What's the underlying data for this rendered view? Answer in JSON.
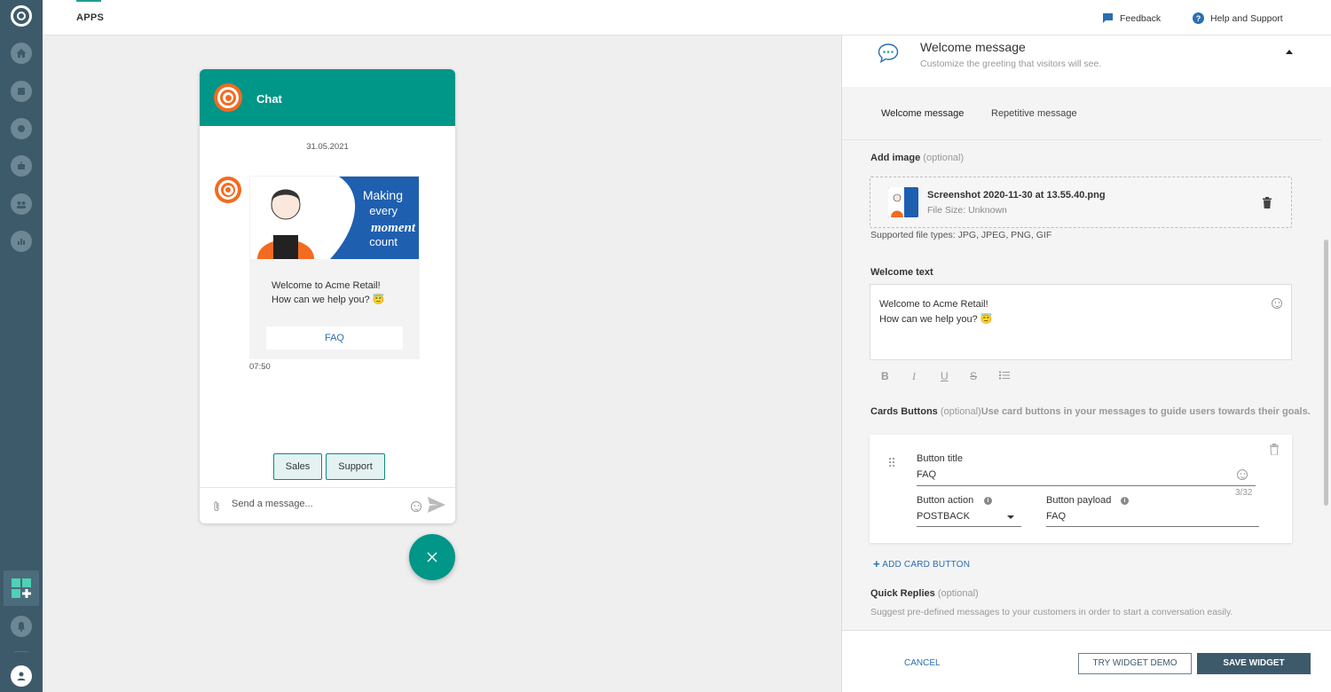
{
  "topbar": {
    "apps_tab": "APPS",
    "feedback": "Feedback",
    "help": "Help and Support"
  },
  "sidebar": {
    "items": [
      "home-icon",
      "conversations-icon",
      "chat-icon",
      "bot-icon",
      "people-icon",
      "analytics-icon",
      "apps-add-icon",
      "bell-icon",
      "user-avatar-icon"
    ]
  },
  "chat_preview": {
    "title": "Chat",
    "date": "31.05.2021",
    "banner_line1": "Making",
    "banner_line2": "every",
    "banner_line3": "moment",
    "banner_line4": "count",
    "message_line1": "Welcome to Acme Retail!",
    "message_line2": "How can we help you? 😇",
    "card_button": "FAQ",
    "time": "07:50",
    "quick_replies": [
      "Sales",
      "Support"
    ],
    "input_placeholder": "Send a message..."
  },
  "panel": {
    "header_title": "Welcome message",
    "header_subtitle": "Customize the greeting that visitors will see.",
    "tabs": [
      "Welcome message",
      "Repetitive message"
    ],
    "add_image_label": "Add image",
    "optional": "(optional)",
    "file_name": "Screenshot 2020-11-30 at 13.55.40.png",
    "file_size": "File Size: Unknown",
    "supported_types": "Supported file types: JPG, JPEG, PNG, GIF",
    "welcome_text_label": "Welcome text",
    "welcome_text_line1": "Welcome to Acme Retail!",
    "welcome_text_line2": "How can we help you? 😇",
    "format_buttons": [
      "B",
      "I",
      "U",
      "S"
    ],
    "cards_label": "Cards Buttons",
    "cards_desc": "Use card buttons in your messages to guide users towards their goals.",
    "button_title_label": "Button title",
    "button_title_value": "FAQ",
    "button_title_counter": "3/32",
    "button_action_label": "Button action",
    "button_action_value": "POSTBACK",
    "button_payload_label": "Button payload",
    "button_payload_value": "FAQ",
    "add_card_button": "ADD CARD BUTTON",
    "quick_replies_label": "Quick Replies",
    "quick_replies_desc": "Suggest pre-defined messages to your customers in order to start a conversation easily.",
    "cancel": "CANCEL",
    "try_demo": "TRY WIDGET DEMO",
    "save": "SAVE WIDGET"
  },
  "colors": {
    "sidebar": "#3d5a6b",
    "teal": "#009688",
    "orange": "#f26b21",
    "link": "#2a6fb0"
  }
}
